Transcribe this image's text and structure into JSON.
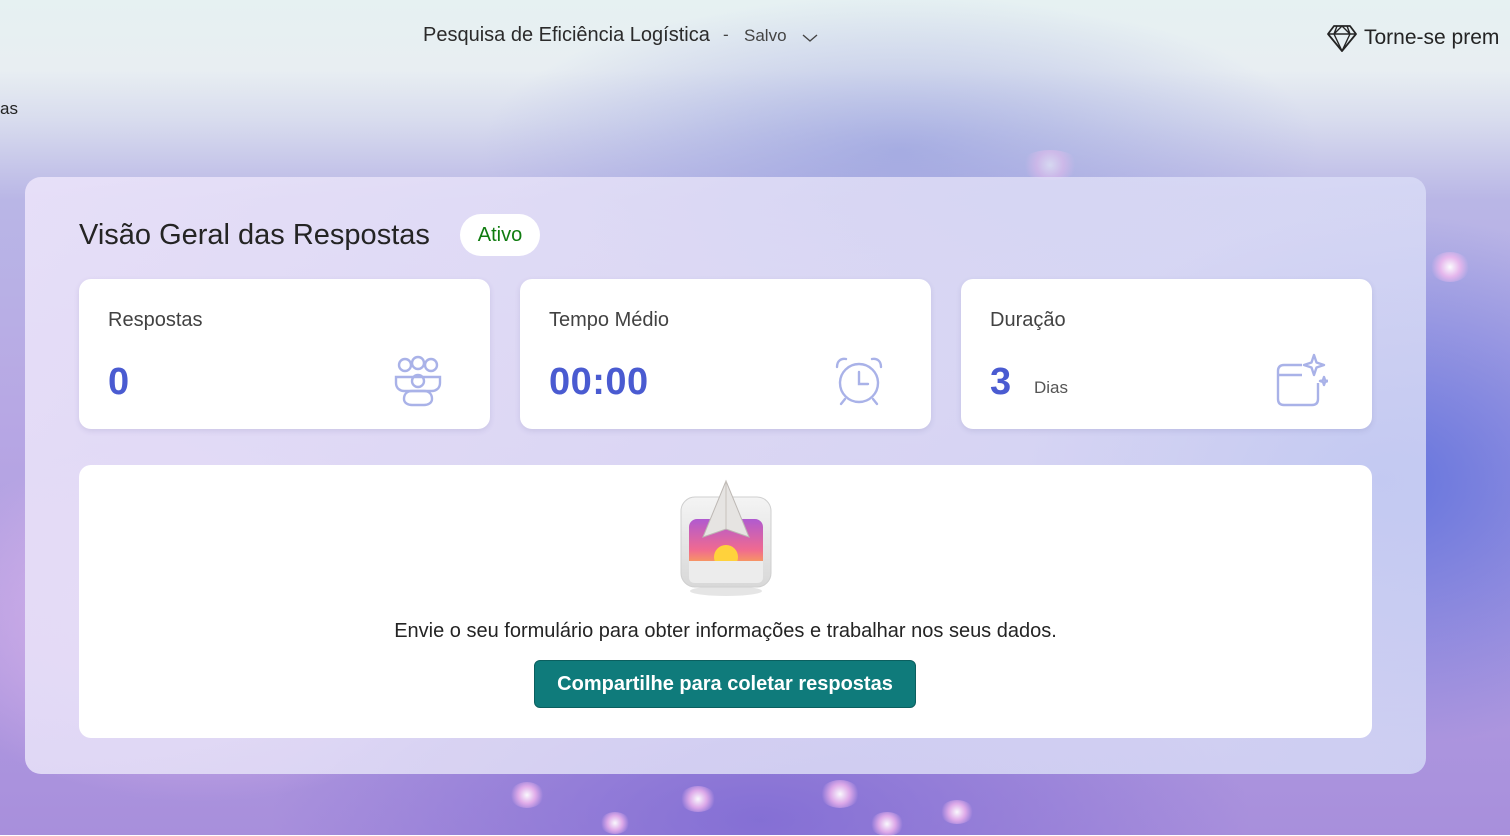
{
  "header": {
    "form_title": "Pesquisa de Eficiência Logística",
    "separator": "-",
    "save_status": "Salvo",
    "premium_label": "Torne-se prem"
  },
  "side": {
    "cut_text": "as"
  },
  "overview": {
    "title": "Visão Geral das Respostas",
    "status_badge": "Ativo",
    "cards": [
      {
        "label": "Respostas",
        "value": "0",
        "unit": "",
        "icon": "people-icon"
      },
      {
        "label": "Tempo Médio",
        "value": "00:00",
        "unit": "",
        "icon": "alarm-clock-icon"
      },
      {
        "label": "Duração",
        "value": "3",
        "unit": "Dias",
        "icon": "calendar-sparkle-icon"
      }
    ]
  },
  "empty_state": {
    "message": "Envie o seu formulário para obter informações e trabalhar nos seus dados.",
    "button_label": "Compartilhe para coletar respostas"
  },
  "colors": {
    "accent_value": "#4a5bd1",
    "status_green": "#107c10",
    "button_teal": "#0f7b7b"
  }
}
